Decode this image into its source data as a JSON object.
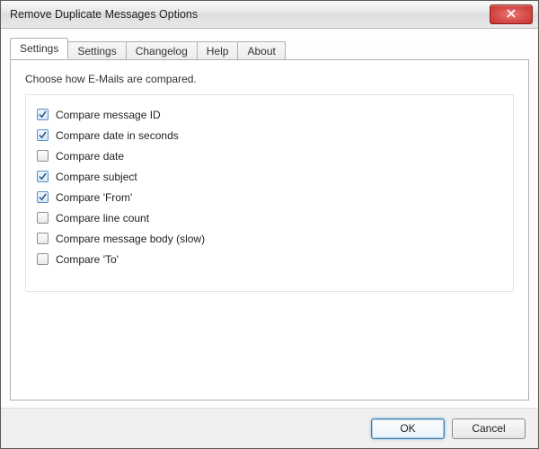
{
  "window": {
    "title": "Remove Duplicate Messages Options"
  },
  "tabs": [
    {
      "label": "Settings",
      "active": true
    },
    {
      "label": "Settings",
      "active": false
    },
    {
      "label": "Changelog",
      "active": false
    },
    {
      "label": "Help",
      "active": false
    },
    {
      "label": "About",
      "active": false
    }
  ],
  "panel": {
    "instruction": "Choose how E-Mails are compared."
  },
  "options": [
    {
      "label": "Compare message ID",
      "checked": true
    },
    {
      "label": "Compare date in seconds",
      "checked": true
    },
    {
      "label": "Compare date",
      "checked": false
    },
    {
      "label": "Compare subject",
      "checked": true
    },
    {
      "label": "Compare 'From'",
      "checked": true
    },
    {
      "label": "Compare line count",
      "checked": false
    },
    {
      "label": "Compare message body (slow)",
      "checked": false
    },
    {
      "label": "Compare 'To'",
      "checked": false
    }
  ],
  "buttons": {
    "ok": "OK",
    "cancel": "Cancel"
  }
}
